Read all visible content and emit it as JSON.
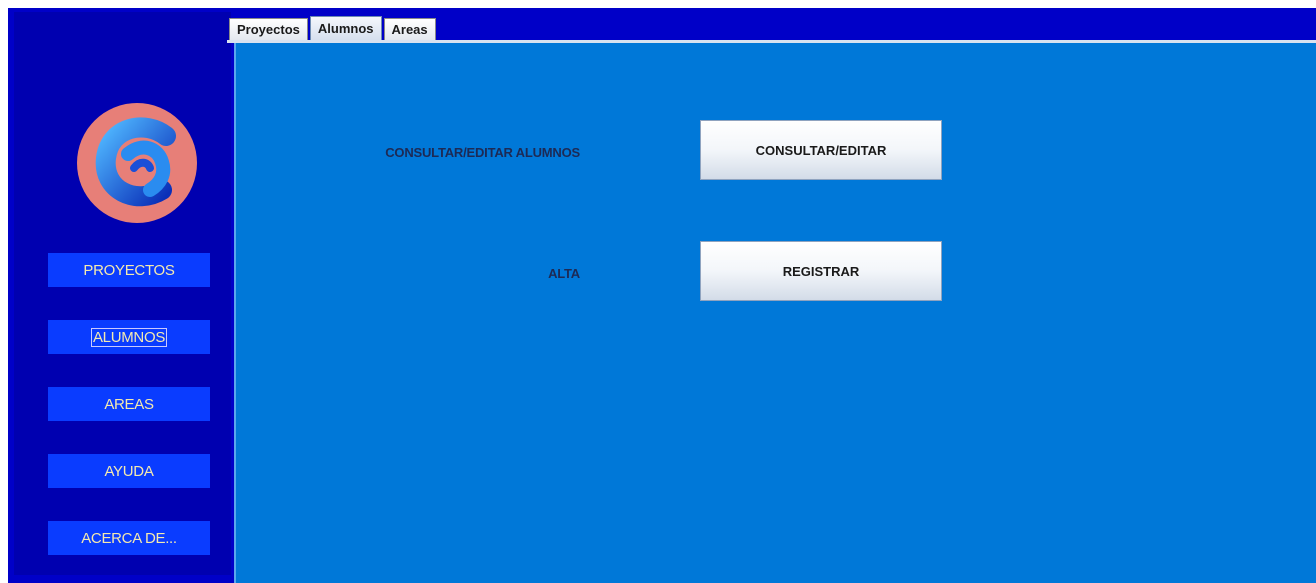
{
  "tabs": [
    {
      "label": "Proyectos"
    },
    {
      "label": "Alumnos",
      "selected": true
    },
    {
      "label": "Areas"
    }
  ],
  "sidebar": {
    "logo_icon": "app-logo-c",
    "items": [
      {
        "label": "PROYECTOS"
      },
      {
        "label": "ALUMNOS",
        "focused": true
      },
      {
        "label": "AREAS"
      },
      {
        "label": "AYUDA"
      },
      {
        "label": "ACERCA DE..."
      }
    ]
  },
  "main": {
    "consult_label": "CONSULTAR/EDITAR ALUMNOS",
    "consult_button": "CONSULTAR/EDITAR",
    "alta_label": "ALTA",
    "register_button": "REGISTRAR"
  },
  "colors": {
    "frame": "#0000c8",
    "sidebar": "#0000b0",
    "sidebar_button": "#0a3cff",
    "sidebar_text": "#f3e9b0",
    "content": "#0078d8"
  }
}
